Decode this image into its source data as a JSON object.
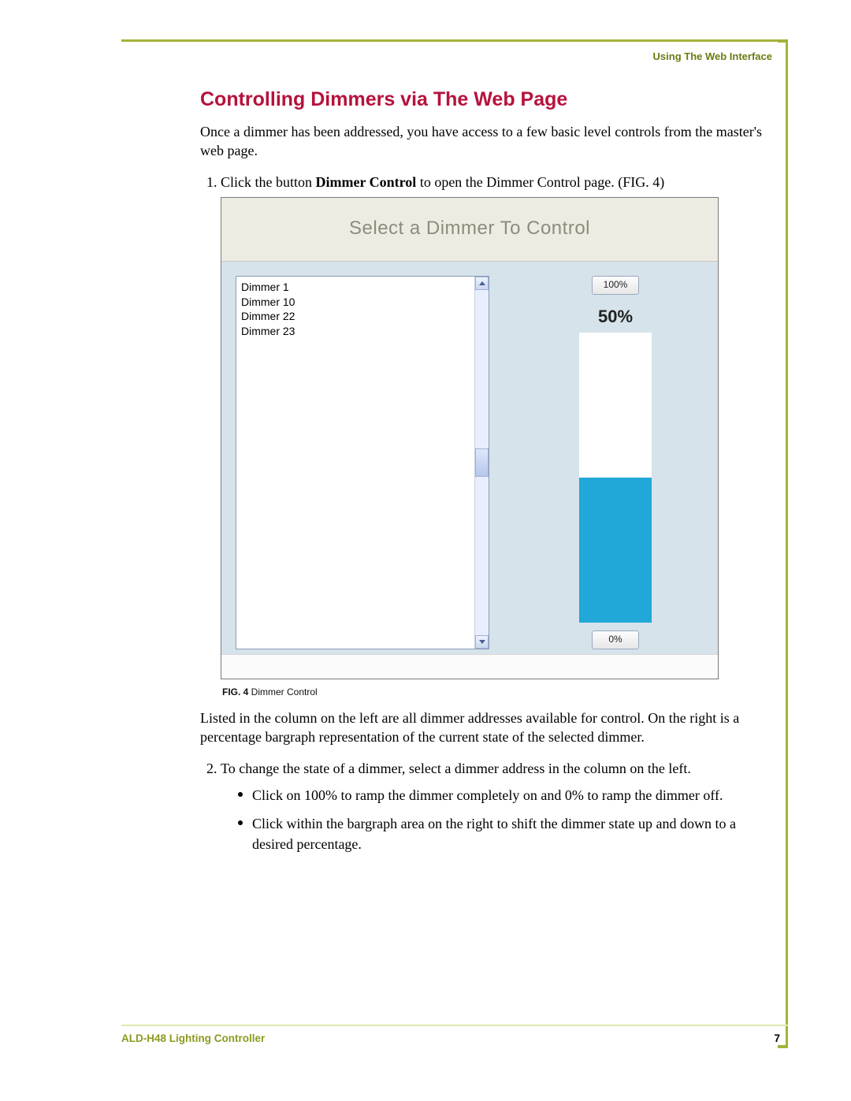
{
  "header": {
    "section_label": "Using The Web Interface"
  },
  "title": "Controlling Dimmers via The Web Page",
  "intro": "Once a dimmer has been addressed, you have access to a few basic level controls from the master's web page.",
  "step1_pre": "Click the button ",
  "step1_bold": "Dimmer Control",
  "step1_post": " to open the Dimmer Control page. (FIG. 4)",
  "figure": {
    "caption_prefix": "FIG. 4",
    "caption_text": "  Dimmer Control",
    "shot_title": "Select a Dimmer To Control",
    "dimmers": [
      "Dimmer 1",
      "Dimmer 10",
      "Dimmer 22",
      "Dimmer 23"
    ],
    "btn_100": "100%",
    "btn_0": "0%",
    "current_pct_label": "50%",
    "current_pct": 50
  },
  "para_after_fig": "Listed in the column on the left are all dimmer addresses available for control. On the right is a percentage bargraph representation of the current state of the selected dimmer.",
  "step2": "To change the state of a dimmer, select a dimmer address in the column on the left.",
  "bullet_a": "Click on 100% to ramp the dimmer completely on and 0% to ramp the dimmer off.",
  "bullet_b": "Click within the bargraph area on the right to shift the dimmer state up and down to a desired percentage.",
  "footer": {
    "product": "ALD-H48 Lighting Controller",
    "page_number": "7"
  }
}
